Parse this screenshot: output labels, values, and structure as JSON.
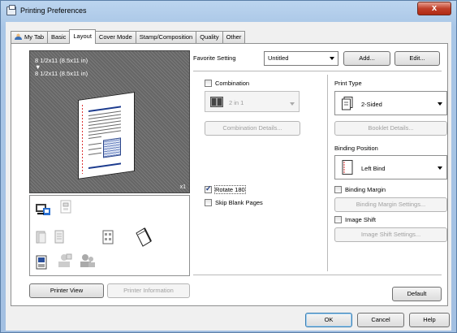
{
  "window": {
    "title": "Printing Preferences",
    "close_label": "x"
  },
  "tabs": [
    {
      "label": "My Tab"
    },
    {
      "label": "Basic"
    },
    {
      "label": "Layout"
    },
    {
      "label": "Cover Mode"
    },
    {
      "label": "Stamp/Composition"
    },
    {
      "label": "Quality"
    },
    {
      "label": "Other"
    }
  ],
  "preview": {
    "line1": "8 1/2x11 (8.5x11 in)",
    "arrow": "▼",
    "line2": "8 1/2x11 (8.5x11 in)",
    "copies": "x1"
  },
  "left_buttons": {
    "printer_view": "Printer View",
    "printer_information": "Printer Information"
  },
  "favorite": {
    "label": "Favorite Setting",
    "value": "Untitled",
    "add": "Add...",
    "edit": "Edit..."
  },
  "combination": {
    "label": "Combination",
    "checked": false,
    "value": "2 in 1",
    "details": "Combination Details..."
  },
  "print_type": {
    "label": "Print Type",
    "value": "2-Sided",
    "booklet": "Booklet Details..."
  },
  "binding_position": {
    "label": "Binding Position",
    "value": "Left Bind"
  },
  "rotate": {
    "label": "Rotate 180",
    "checked": true
  },
  "skip_blank": {
    "label": "Skip Blank Pages",
    "checked": false
  },
  "binding_margin": {
    "label": "Binding Margin",
    "checked": false,
    "settings": "Binding Margin Settings..."
  },
  "image_shift": {
    "label": "Image Shift",
    "checked": false,
    "settings": "Image Shift Settings..."
  },
  "default_button": "Default",
  "dialog_buttons": {
    "ok": "OK",
    "cancel": "Cancel",
    "help": "Help"
  },
  "colors": {
    "accent": "#1c3b8e",
    "title_close": "#c0402a",
    "disabled_text": "#a0a0a0"
  }
}
